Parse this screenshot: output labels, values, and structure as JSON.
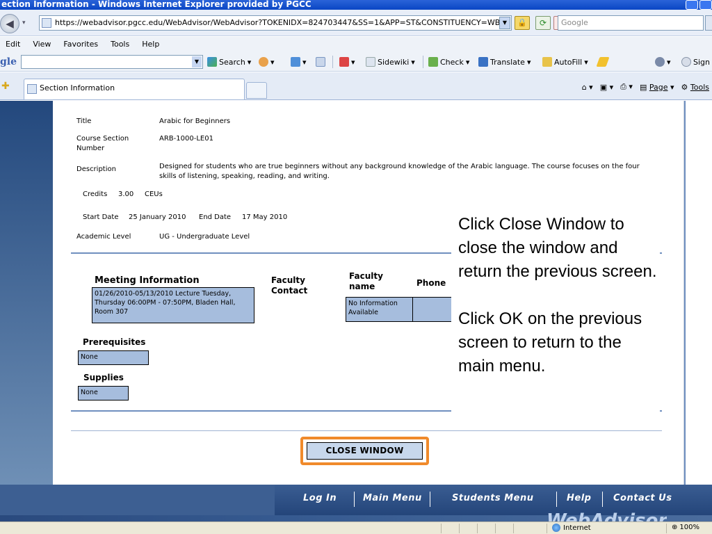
{
  "window": {
    "title": "ection Information - Windows Internet Explorer provided by PGCC"
  },
  "address": {
    "url": "https://webadvisor.pgcc.edu/WebAdvisor/WebAdvisor?TOKENIDX=824703447&SS=1&APP=ST&CONSTITUENCY=WB",
    "search_placeholder": "Google"
  },
  "menu": [
    "Edit",
    "View",
    "Favorites",
    "Tools",
    "Help"
  ],
  "google_toolbar": {
    "logo": "gle",
    "search": "Search",
    "sidewiki": "Sidewiki",
    "check": "Check",
    "translate": "Translate",
    "autofill": "AutoFill",
    "sign": "Sign"
  },
  "tab": {
    "title": "Section Information"
  },
  "commandbar": {
    "page": "Page",
    "tools": "Tools"
  },
  "section": {
    "title_label": "Title",
    "title_value": "Arabic for Beginners",
    "number_label": "Course Section Number",
    "number_value": "ARB-1000-LE01",
    "description_label": "Description",
    "description_value": "Designed for students who are true beginners without any background knowledge of the Arabic language. The course focuses on the four skills of listening, speaking, reading, and writing.",
    "credits_label": "Credits",
    "credits_value": "3.00",
    "ceus_label": "CEUs",
    "start_label": "Start Date",
    "start_value": "25 January 2010",
    "end_label": "End Date",
    "end_value": "17 May 2010",
    "level_label": "Academic Level",
    "level_value": "UG - Undergraduate Level"
  },
  "meeting": {
    "heading": "Meeting Information",
    "value": "01/26/2010-05/13/2010 Lecture Tuesday, Thursday 06:00PM - 07:50PM, Bladen Hall, Room 307",
    "faculty_contact": "Faculty Contact",
    "faculty_name_heading": "Faculty name",
    "faculty_name_value": "No Information Available",
    "phone_heading": "Phone"
  },
  "prerequisites": {
    "heading": "Prerequisites",
    "value": "None"
  },
  "supplies": {
    "heading": "Supplies",
    "value": "None"
  },
  "annotation": {
    "para1": "Click Close Window to close the window and return the previous screen.",
    "para2": "Click OK on the previous screen to return to the main menu."
  },
  "close_button": "CLOSE WINDOW",
  "footer_nav": [
    "Log In",
    "Main Menu",
    "Students Menu",
    "Help",
    "Contact Us"
  ],
  "footer_brand": "WebAdvisor",
  "status": {
    "zone": "Internet",
    "zoom": "100%"
  },
  "colors": {
    "highlight": "#f08a2b",
    "box_fill": "#a6bddd",
    "nav_blue": "#2a4a7e"
  }
}
